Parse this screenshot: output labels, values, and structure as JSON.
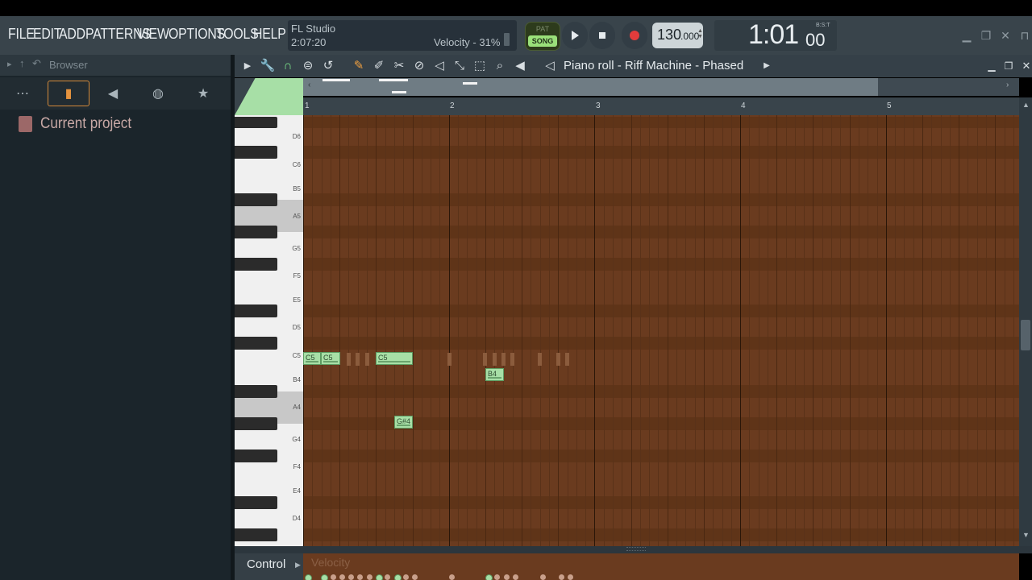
{
  "menu": [
    "FILE",
    "EDIT",
    "ADD",
    "PATTERNS",
    "VIEW",
    "OPTIONS",
    "TOOLS",
    "HELP"
  ],
  "hint": {
    "app": "FL Studio",
    "time": "2:07:20",
    "velocity": "Velocity - 31%"
  },
  "pat_song": {
    "pat": "PAT",
    "song": "SONG"
  },
  "tempo": {
    "int": "130",
    "frac": ".000"
  },
  "clock": {
    "display": "1:01",
    "sub": "00",
    "label": "B:S:T"
  },
  "browser": {
    "title": "Browser",
    "current_project": "Current project"
  },
  "piano_roll": {
    "title": "Piano roll - Riff Machine - Phased"
  },
  "timeline": {
    "bars": [
      "1",
      "2",
      "3",
      "4",
      "5"
    ]
  },
  "keys": [
    "D6",
    "C6",
    "B5",
    "A5",
    "G5",
    "F5",
    "E5",
    "D5",
    "C5",
    "B4",
    "A4",
    "G4",
    "F4",
    "E4",
    "D4"
  ],
  "notes": [
    {
      "label": "C5",
      "pitch": "C5"
    },
    {
      "label": "C5",
      "pitch": "C5"
    },
    {
      "label": "C5",
      "pitch": "C5"
    },
    {
      "label": "B4",
      "pitch": "B4"
    },
    {
      "label": "G#4",
      "pitch": "G#4"
    }
  ],
  "control": {
    "label": "Control",
    "lane": "Velocity"
  },
  "colors": {
    "grid": "#6a3b1f",
    "note": "#a7dfa6",
    "accent_green": "#9ae07a",
    "record": "#e23c3c"
  }
}
